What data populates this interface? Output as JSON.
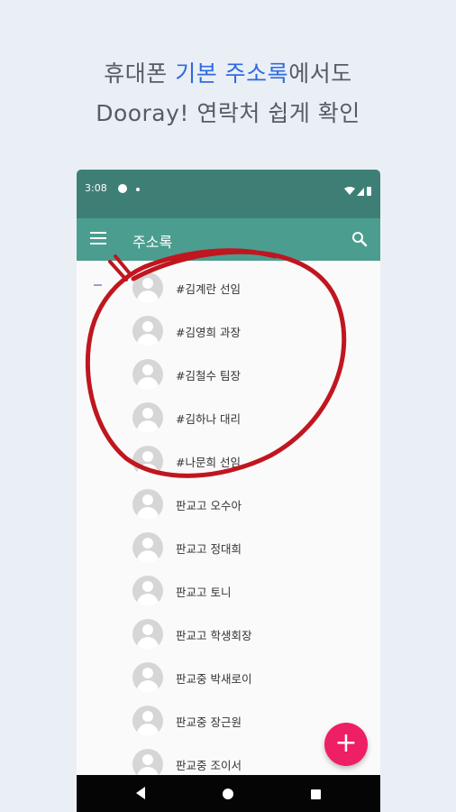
{
  "headline": {
    "line1_before": "휴대폰 ",
    "line1_accent": "기본 주소록",
    "line1_after": "에서도",
    "line2": "Dooray! 연락처 쉽게 확인"
  },
  "statusbar": {
    "time": "3:08"
  },
  "appbar": {
    "title": "주소록"
  },
  "contacts": [
    "#김계란 선임",
    "#김영희 과장",
    "#김철수 팀장",
    "#김하나 대리",
    "#나문희 선임",
    "판교고 오수아",
    "판교고 정대희",
    "판교고 토니",
    "판교고 학생회장",
    "판교중 박새로이",
    "판교중 장근원",
    "판교중 조이서"
  ],
  "fab": {
    "label": "+"
  },
  "colors": {
    "statusbar": "#3e7f75",
    "appbar": "#4b9d8f",
    "fab": "#ee1f64",
    "accent_text": "#2f6ae0",
    "annotation": "#c0161f"
  }
}
